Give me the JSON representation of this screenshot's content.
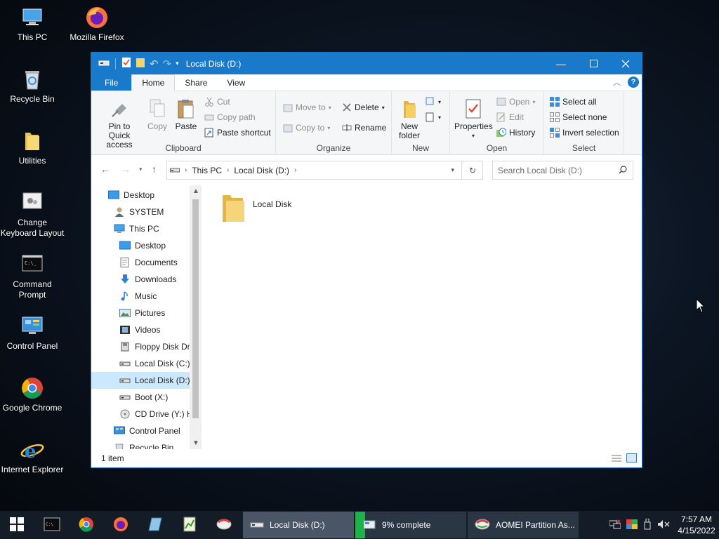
{
  "desktop": {
    "icons": [
      {
        "label": "This PC"
      },
      {
        "label": "Mozilla Firefox"
      },
      {
        "label": "Recycle Bin"
      },
      {
        "label": "Utilities"
      },
      {
        "label": "Change Keyboard Layout"
      },
      {
        "label": "Command Prompt"
      },
      {
        "label": "Control Panel"
      },
      {
        "label": "Google Chrome"
      },
      {
        "label": "Internet Explorer"
      }
    ]
  },
  "window": {
    "title": "Local Disk (D:)",
    "tabs": {
      "file": "File",
      "home": "Home",
      "share": "Share",
      "view": "View"
    },
    "help": "?",
    "ribbon": {
      "clipboard": {
        "label": "Clipboard",
        "pin": "Pin to Quick access",
        "copy": "Copy",
        "paste": "Paste",
        "cut": "Cut",
        "copy_path": "Copy path",
        "paste_shortcut": "Paste shortcut"
      },
      "organize": {
        "label": "Organize",
        "move_to": "Move to",
        "copy_to": "Copy to",
        "delete": "Delete",
        "rename": "Rename"
      },
      "new": {
        "label": "New",
        "new_folder": "New folder"
      },
      "open": {
        "label": "Open",
        "properties": "Properties",
        "open": "Open",
        "edit": "Edit",
        "history": "History"
      },
      "select": {
        "label": "Select",
        "select_all": "Select all",
        "select_none": "Select none",
        "invert": "Invert selection"
      }
    },
    "address": {
      "this_pc": "This PC",
      "current": "Local Disk (D:)"
    },
    "search": {
      "placeholder": "Search Local Disk (D:)"
    },
    "nav": [
      {
        "label": "Desktop"
      },
      {
        "label": "SYSTEM"
      },
      {
        "label": "This PC"
      },
      {
        "label": "Desktop"
      },
      {
        "label": "Documents"
      },
      {
        "label": "Downloads"
      },
      {
        "label": "Music"
      },
      {
        "label": "Pictures"
      },
      {
        "label": "Videos"
      },
      {
        "label": "Floppy Disk Dri"
      },
      {
        "label": "Local Disk (C:)"
      },
      {
        "label": "Local Disk (D:)"
      },
      {
        "label": "Boot (X:)"
      },
      {
        "label": "CD Drive (Y:) H"
      },
      {
        "label": "Control Panel"
      },
      {
        "label": "Recycle Bin"
      }
    ],
    "files": [
      {
        "name": "Local Disk"
      }
    ],
    "status": "1 item"
  },
  "taskbar": {
    "tasks": [
      {
        "label": "Local Disk (D:)"
      },
      {
        "label": "9% complete"
      },
      {
        "label": "AOMEI Partition As..."
      }
    ],
    "progress_percent": 9,
    "clock": {
      "time": "7:57 AM",
      "date": "4/15/2022"
    }
  }
}
